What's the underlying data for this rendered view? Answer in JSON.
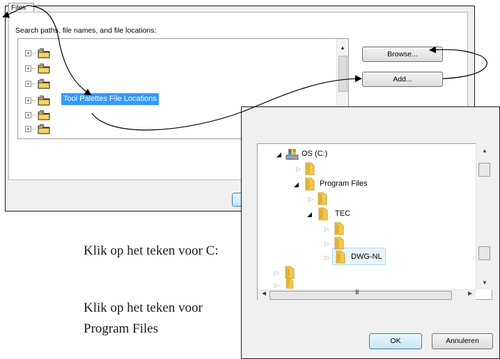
{
  "files_dialog": {
    "tab_label": "Files",
    "search_label": "Search paths, file names, and file locations:",
    "selected_item": "Tool Palettes File Locations",
    "browse_label": "Browse...",
    "add_label": "Add..."
  },
  "folder_dialog": {
    "tree": {
      "drive_label": "OS (C:)",
      "program_files_label": "Program Files",
      "tec_label": "TEC",
      "dwg_label": "DWG-NL"
    },
    "hscroll_grip": "III",
    "ok_label": "OK",
    "cancel_label": "Annuleren"
  },
  "instructions": {
    "step1": "Klik op het teken voor C:",
    "step2_line1": "Klik op het teken voor",
    "step2_line2": "Program Files"
  },
  "colors": {
    "selection": "#3399ff",
    "dialog_bg": "#f0f0f0",
    "folder_yellow": "#f5d35e"
  },
  "icons": [
    "plus-box-icon",
    "folder-icon",
    "drive-icon",
    "expand-triangle-icon",
    "collapse-triangle-icon",
    "arrow-icon"
  ]
}
